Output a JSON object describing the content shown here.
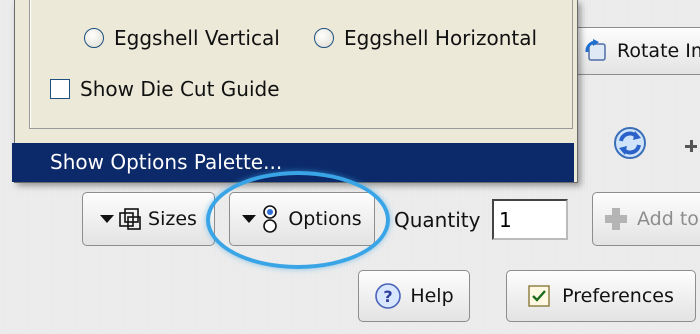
{
  "menu": {
    "eggshell_vertical": "Eggshell Vertical",
    "eggshell_horizontal": "Eggshell Horizontal",
    "show_die_cut_guide": "Show Die Cut Guide",
    "show_options_palette": "Show Options Palette..."
  },
  "toolbar": {
    "rotate_label": "Rotate Im",
    "sizes_label": "Sizes",
    "options_label": "Options",
    "quantity_label": "Quantity",
    "quantity_value": "1",
    "add_label": "Add to",
    "help_label": "Help",
    "preferences_label": "Preferences"
  },
  "colors": {
    "menu_highlight": "#0c2a6a",
    "callout_outline": "#3aa5e6"
  }
}
